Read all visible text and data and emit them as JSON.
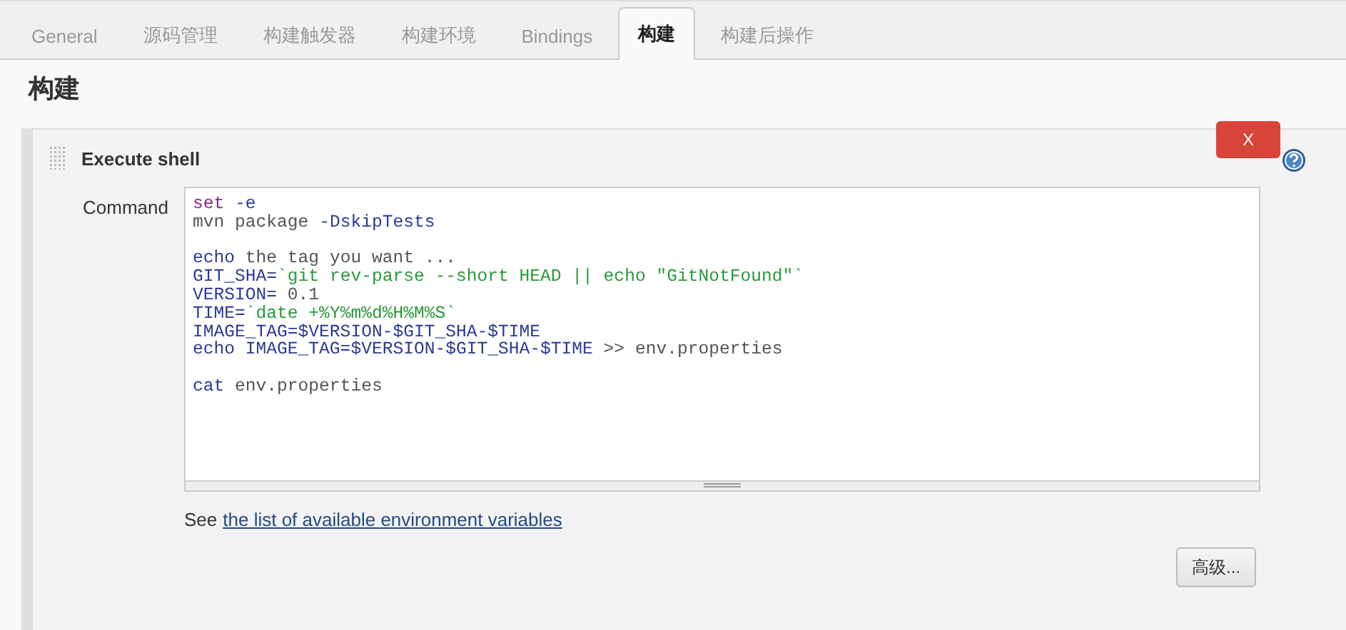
{
  "tabs": [
    {
      "label": "General",
      "selected": false
    },
    {
      "label": "源码管理",
      "selected": false
    },
    {
      "label": "构建触发器",
      "selected": false
    },
    {
      "label": "构建环境",
      "selected": false
    },
    {
      "label": "Bindings",
      "selected": false
    },
    {
      "label": "构建",
      "selected": true
    },
    {
      "label": "构建后操作",
      "selected": false
    }
  ],
  "section_title": "构建",
  "build_step": {
    "title": "Execute shell",
    "delete_button": "X",
    "command_label": "Command",
    "command_lines": [
      [
        [
          {
            "kind": "keyword",
            "text": "set"
          },
          {
            "kind": "variable",
            "text": " -e"
          }
        ],
        [
          {
            "kind": "plain",
            "text": "mvn package "
          },
          {
            "kind": "variable",
            "text": "-DskipTests"
          }
        ]
      ],
      [
        [
          {
            "kind": "variable",
            "text": "echo"
          },
          {
            "kind": "plain",
            "text": " the tag you want ..."
          }
        ],
        [
          {
            "kind": "variable",
            "text": "GIT_SHA="
          },
          {
            "kind": "string",
            "text": "`git rev-parse --short HEAD || echo \"GitNotFound\"`"
          }
        ],
        [
          {
            "kind": "variable",
            "text": "VERSION="
          },
          {
            "kind": "plain",
            "text": " 0.1"
          }
        ],
        [
          {
            "kind": "variable",
            "text": "TIME="
          },
          {
            "kind": "string",
            "text": "`date +%Y%m%d%H%M%S`"
          }
        ],
        [
          {
            "kind": "variable",
            "text": "IMAGE_TAG=$VERSION-$GIT_SHA-$TIME"
          }
        ],
        [
          {
            "kind": "variable",
            "text": "echo IMAGE_TAG=$VERSION-$GIT_SHA-$TIME"
          },
          {
            "kind": "plain",
            "text": " >> env.properties"
          }
        ]
      ],
      [
        [
          {
            "kind": "variable",
            "text": "cat"
          },
          {
            "kind": "plain",
            "text": " env.properties"
          }
        ]
      ]
    ],
    "hint_prefix": "See",
    "hint_link": "the list of available environment variables",
    "advanced_button": "高级..."
  }
}
